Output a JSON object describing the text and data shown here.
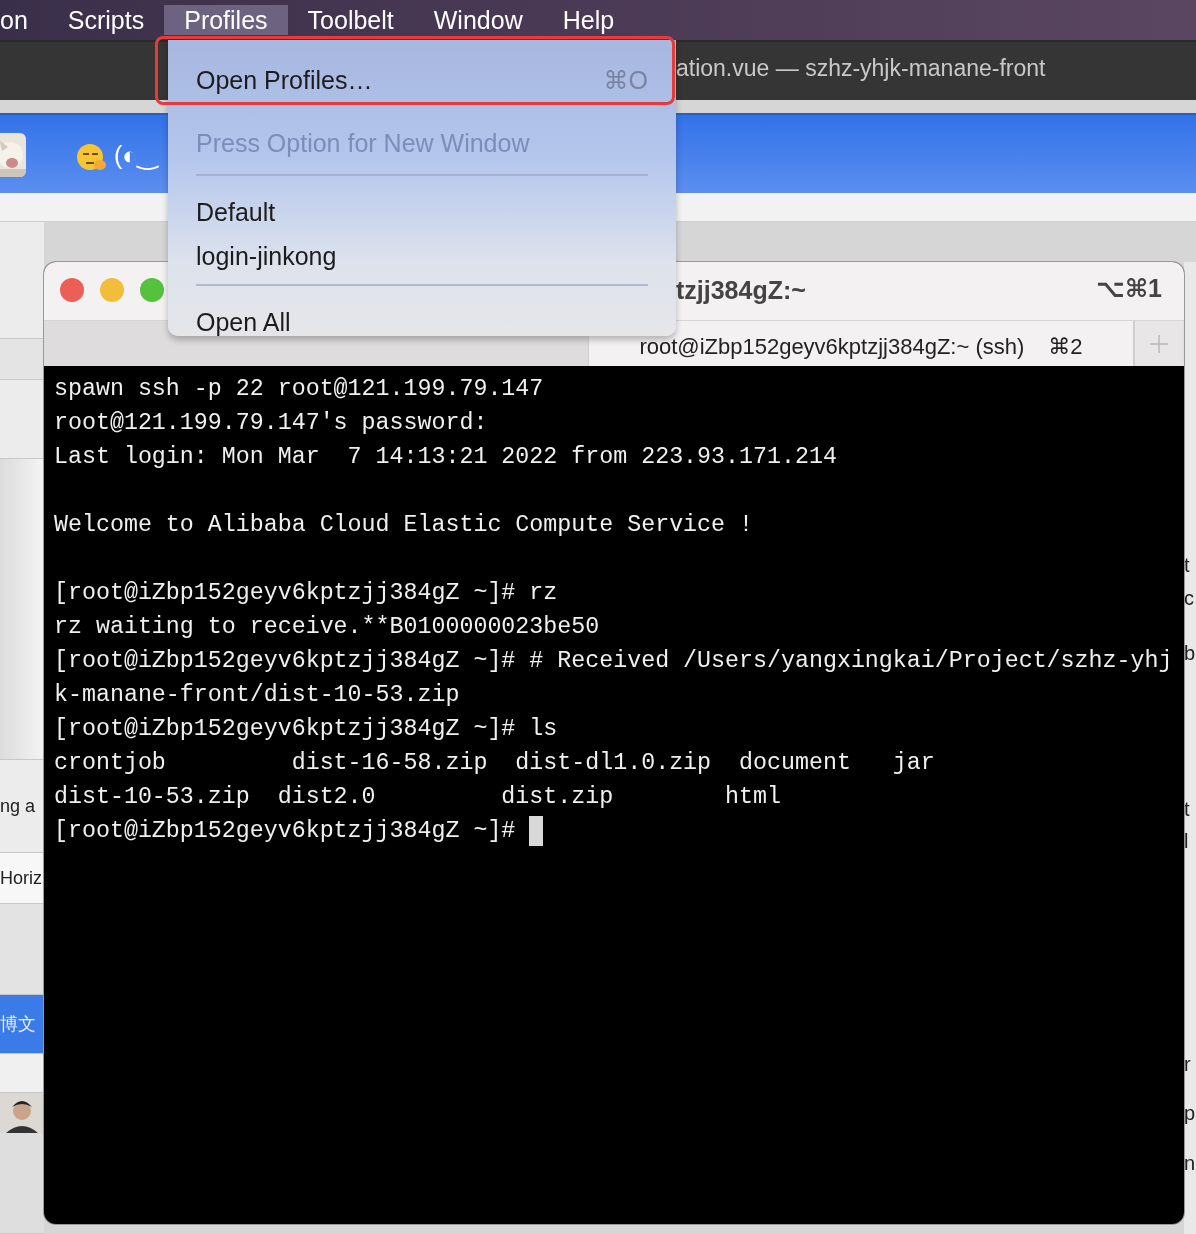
{
  "menu_bar": {
    "items": [
      {
        "label": "on",
        "selected": false
      },
      {
        "label": "Scripts",
        "selected": false
      },
      {
        "label": "Profiles",
        "selected": true
      },
      {
        "label": "Toolbelt",
        "selected": false
      },
      {
        "label": "Window",
        "selected": false
      },
      {
        "label": "Help",
        "selected": false
      }
    ]
  },
  "editor_window": {
    "title": "ation.vue — szhz-yhjk-manane-front"
  },
  "browser": {
    "toolbar_text": "(◐‿",
    "left_fragments": [
      "ng a",
      "Horiz"
    ],
    "left_tab": "博文",
    "right_fragments": [
      "t",
      "c",
      "b",
      "t",
      "l",
      "r",
      "p",
      "n"
    ]
  },
  "terminal": {
    "title": "tzjj384gZ:~",
    "title_shortcut": "⌥⌘1",
    "tabs": [
      {
        "selected": false
      },
      {
        "label": "root@iZbp152geyv6kptzjj384gZ:~ (ssh)",
        "shortcut": "⌘2",
        "selected": true
      }
    ],
    "lines": [
      {
        "kind": "text",
        "text": "spawn ssh -p 22 root@121.199.79.147"
      },
      {
        "kind": "text",
        "text": "root@121.199.79.147's password:"
      },
      {
        "kind": "text",
        "text": "Last login: Mon Mar  7 14:13:21 2022 from 223.93.171.214"
      },
      {
        "kind": "blank"
      },
      {
        "kind": "text",
        "text": "Welcome to Alibaba Cloud Elastic Compute Service !"
      },
      {
        "kind": "blank"
      },
      {
        "kind": "text",
        "text": "[root@iZbp152geyv6kptzjj384gZ ~]# rz"
      },
      {
        "kind": "text",
        "text": "rz waiting to receive.**B0100000023be50"
      },
      {
        "kind": "text",
        "text": "[root@iZbp152geyv6kptzjj384gZ ~]# # Received /Users/yangxingkai/Project/szhz-yhj"
      },
      {
        "kind": "text",
        "text": "k-manane-front/dist-10-53.zip"
      },
      {
        "kind": "text",
        "text": "[root@iZbp152geyv6kptzjj384gZ ~]# ls"
      },
      {
        "kind": "text",
        "text": "crontjob         dist-16-58.zip  dist-dl1.0.zip  document   jar"
      },
      {
        "kind": "text",
        "text": "dist-10-53.zip  dist2.0         dist.zip        html"
      },
      {
        "kind": "text",
        "text": "[root@iZbp152geyv6kptzjj384gZ ~]#",
        "cursor": true
      }
    ]
  },
  "profiles_menu": {
    "items": [
      {
        "kind": "item",
        "label": "Open Profiles…",
        "shortcut": "⌘O",
        "highlighted": true
      },
      {
        "kind": "item",
        "label": "Press Option for New Window",
        "disabled": true
      },
      {
        "kind": "separator"
      },
      {
        "kind": "item",
        "label": "Default"
      },
      {
        "kind": "item",
        "label": "login-jinkong"
      },
      {
        "kind": "separator"
      },
      {
        "kind": "item",
        "label": "Open All"
      }
    ]
  }
}
